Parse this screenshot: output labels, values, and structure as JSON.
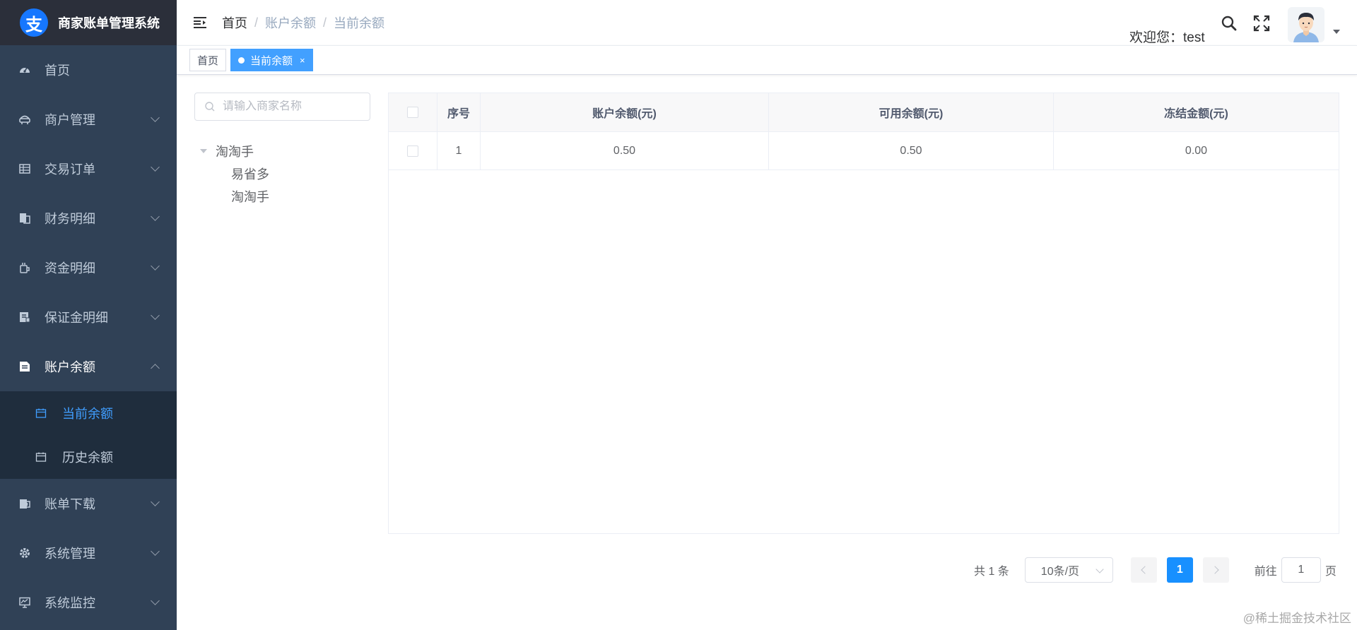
{
  "app": {
    "title": "商家账单管理系统",
    "logo_char": "支"
  },
  "sidebar": {
    "items": [
      {
        "label": "首页",
        "icon": "dashboard-icon"
      },
      {
        "label": "商户管理",
        "icon": "merchant-icon"
      },
      {
        "label": "交易订单",
        "icon": "order-table-icon"
      },
      {
        "label": "财务明细",
        "icon": "finance-icon"
      },
      {
        "label": "资金明细",
        "icon": "funds-icon"
      },
      {
        "label": "保证金明细",
        "icon": "deposit-icon"
      },
      {
        "label": "账户余额",
        "icon": "document-icon"
      },
      {
        "label": "账单下载",
        "icon": "download-icon"
      },
      {
        "label": "系统管理",
        "icon": "gear-icon"
      },
      {
        "label": "系统监控",
        "icon": "monitor-icon"
      }
    ],
    "sub_items": [
      {
        "label": "当前余额",
        "icon": "calendar-icon"
      },
      {
        "label": "历史余额",
        "icon": "calendar-icon"
      }
    ]
  },
  "header": {
    "breadcrumb": [
      "首页",
      "账户余额",
      "当前余额"
    ],
    "breadcrumb_sep": "/",
    "welcome": "欢迎您：test"
  },
  "tags": {
    "home": "首页",
    "current": "当前余额",
    "close": "×"
  },
  "tree": {
    "search_placeholder": "请输入商家名称",
    "root": "淘淘手",
    "children": [
      "易省多",
      "淘淘手"
    ]
  },
  "table": {
    "headers": [
      "序号",
      "账户余额(元)",
      "可用余额(元)",
      "冻结金额(元)"
    ],
    "rows": [
      {
        "index": "1",
        "balance": "0.50",
        "available": "0.50",
        "frozen": "0.00"
      }
    ]
  },
  "pagination": {
    "total": "共 1 条",
    "page_size": "10条/页",
    "current_page": "1",
    "goto_label": "前往",
    "goto_value": "1",
    "page_suffix": "页"
  },
  "watermark": "@稀土掘金技术社区",
  "colors": {
    "sidebar_bg": "#304156",
    "accent": "#409eff",
    "tag_active": "#42a0ff",
    "page_active": "#1890ff"
  }
}
